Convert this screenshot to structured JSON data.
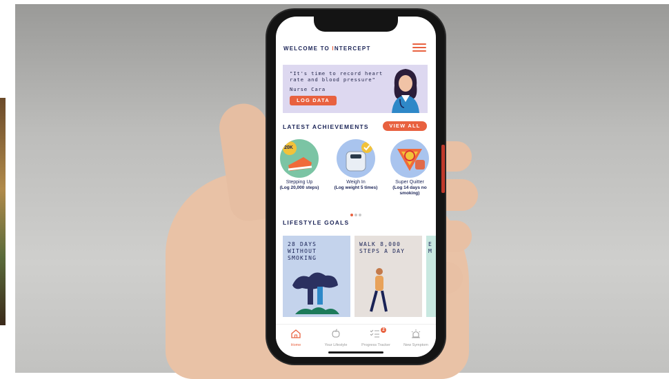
{
  "header": {
    "welcome_prefix": "WELCOME TO ",
    "welcome_brand_first": "I",
    "welcome_brand_rest": "NTERCEPT",
    "menu_icon": "hamburger-menu-icon"
  },
  "banner": {
    "quote": "\"It's time to record heart rate and blood pressure\"",
    "author": "Nurse Cara",
    "button_label": "LOG DATA"
  },
  "achievements": {
    "title": "LATEST ACHIEVEMENTS",
    "view_all_label": "VIEW ALL",
    "items": [
      {
        "title": "Stepping Up",
        "desc": "(Log 20,000 steps)",
        "badge": "20K"
      },
      {
        "title": "Weigh In",
        "desc": "(Log weight 5 times)"
      },
      {
        "title": "Super Quitter",
        "desc": "(Log 14 days no smoking)"
      }
    ]
  },
  "lifestyle_goals": {
    "title": "LIFESTYLE GOALS",
    "items": [
      {
        "text": "28 DAYS\nWITHOUT\nSMOKING"
      },
      {
        "text": "WALK 8,000\nSTEPS A DAY"
      },
      {
        "text": "E\nM"
      }
    ]
  },
  "tabbar": {
    "items": [
      {
        "label": "Home",
        "icon": "home-icon"
      },
      {
        "label": "Your Lifestyle",
        "icon": "apple-icon"
      },
      {
        "label": "Progress Tracker",
        "icon": "checklist-icon",
        "badge": "2"
      },
      {
        "label": "New Symptom",
        "icon": "alarm-icon"
      }
    ]
  },
  "colors": {
    "accent": "#e8613f",
    "navy": "#1a2356",
    "banner_bg": "#ddd8f0"
  }
}
